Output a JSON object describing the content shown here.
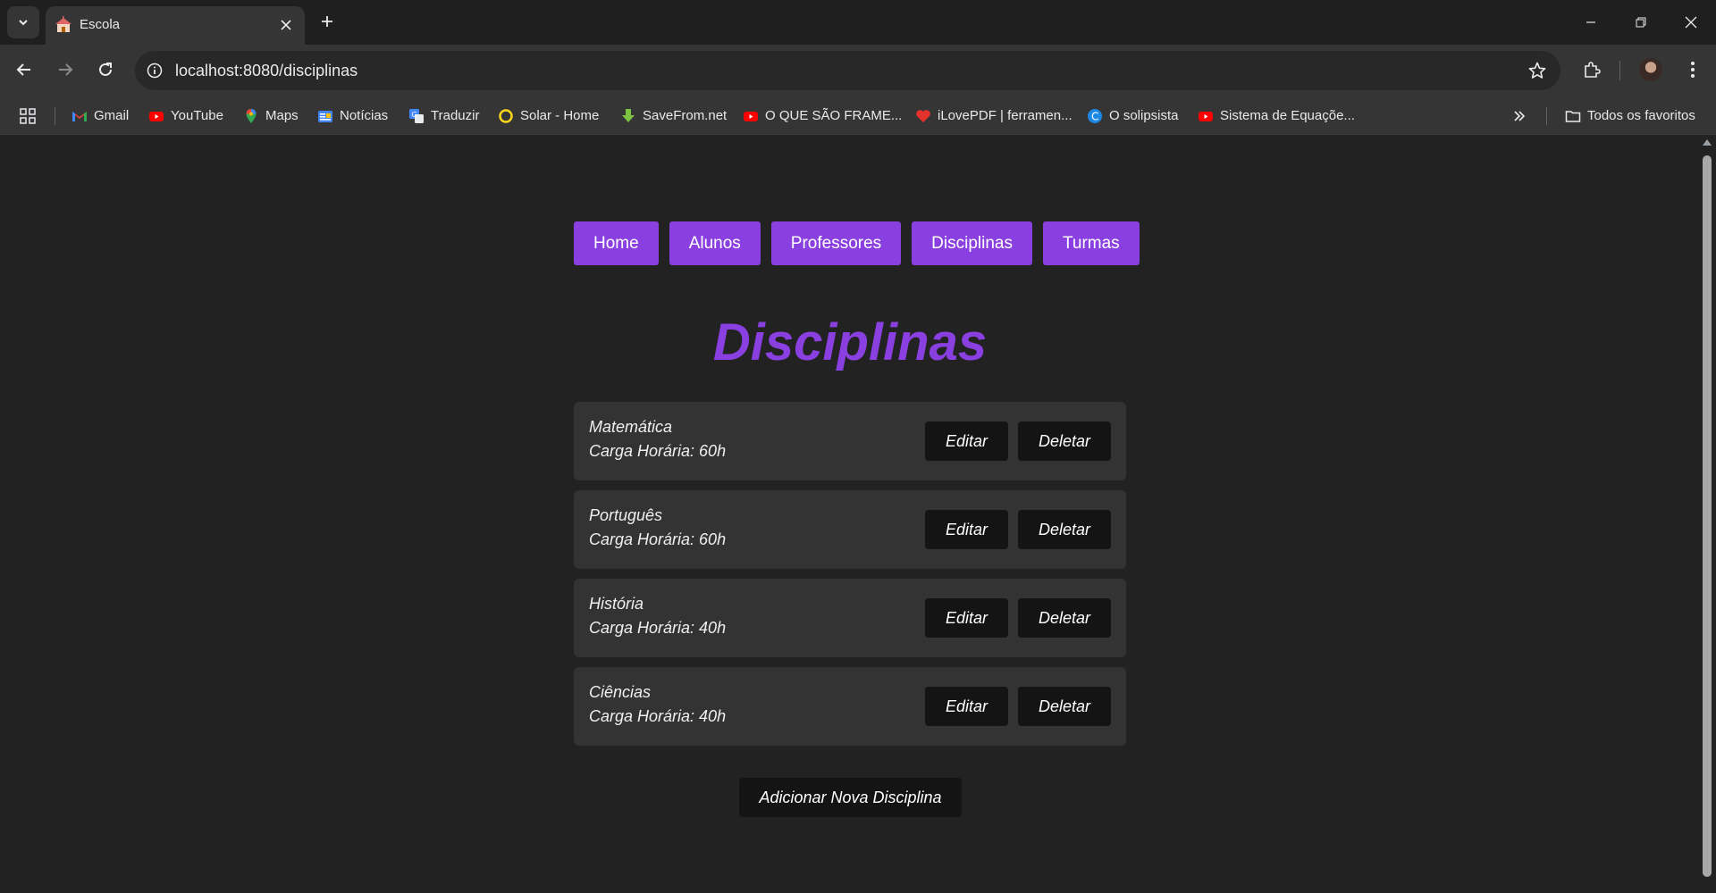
{
  "browser": {
    "tab_title": "Escola",
    "url": "localhost:8080/disciplinas",
    "bookmarks": [
      {
        "label": "Gmail",
        "icon": "gmail-icon"
      },
      {
        "label": "YouTube",
        "icon": "youtube-icon"
      },
      {
        "label": "Maps",
        "icon": "maps-icon"
      },
      {
        "label": "Notícias",
        "icon": "news-icon"
      },
      {
        "label": "Traduzir",
        "icon": "translate-icon"
      },
      {
        "label": "Solar - Home",
        "icon": "solar-icon"
      },
      {
        "label": "SaveFrom.net",
        "icon": "savefrom-icon"
      },
      {
        "label": "O QUE SÃO FRAME...",
        "icon": "youtube-icon"
      },
      {
        "label": "iLovePDF | ferramen...",
        "icon": "ilovepdf-icon"
      },
      {
        "label": "O solipsista",
        "icon": "solipsista-icon"
      },
      {
        "label": "Sistema de Equaçõe...",
        "icon": "youtube-icon"
      }
    ],
    "all_bookmarks_label": "Todos os favoritos"
  },
  "nav": {
    "home": "Home",
    "alunos": "Alunos",
    "professores": "Professores",
    "disciplinas": "Disciplinas",
    "turmas": "Turmas"
  },
  "page": {
    "title": "Disciplinas",
    "edit_label": "Editar",
    "delete_label": "Deletar",
    "add_label": "Adicionar Nova Disciplina"
  },
  "disciplinas": [
    {
      "name": "Matemática",
      "hours": "Carga Horária: 60h"
    },
    {
      "name": "Português",
      "hours": "Carga Horária: 60h"
    },
    {
      "name": "História",
      "hours": "Carga Horária: 40h"
    },
    {
      "name": "Ciências",
      "hours": "Carga Horária: 40h"
    }
  ],
  "colors": {
    "accent": "#8a3fe0",
    "background": "#222222",
    "card": "#333333",
    "button_dark": "#141414"
  }
}
